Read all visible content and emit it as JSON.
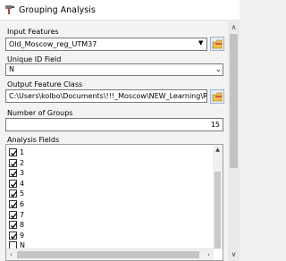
{
  "window": {
    "title": "Grouping Analysis",
    "icon": "hammer-icon"
  },
  "input_features": {
    "label": "Input Features",
    "value": "Old_Moscow_reg_UTM37",
    "browse_icon": "folder-icon"
  },
  "unique_id": {
    "label": "Unique ID Field",
    "value": "N"
  },
  "output_feature_class": {
    "label": "Output Feature Class",
    "value": "C:\\Users\\kolbo\\Documents\\!!!_Moscow\\NEW_Learning\\Reg_",
    "browse_icon": "folder-icon"
  },
  "number_of_groups": {
    "label": "Number of Groups",
    "value": "15"
  },
  "analysis_fields": {
    "label": "Analysis Fields",
    "items": [
      {
        "label": "1",
        "checked": true
      },
      {
        "label": "2",
        "checked": true
      },
      {
        "label": "3",
        "checked": true
      },
      {
        "label": "4",
        "checked": true
      },
      {
        "label": "5",
        "checked": true
      },
      {
        "label": "6",
        "checked": true
      },
      {
        "label": "7",
        "checked": true
      },
      {
        "label": "8",
        "checked": true
      },
      {
        "label": "9",
        "checked": true
      },
      {
        "label": "N",
        "checked": false
      }
    ]
  }
}
